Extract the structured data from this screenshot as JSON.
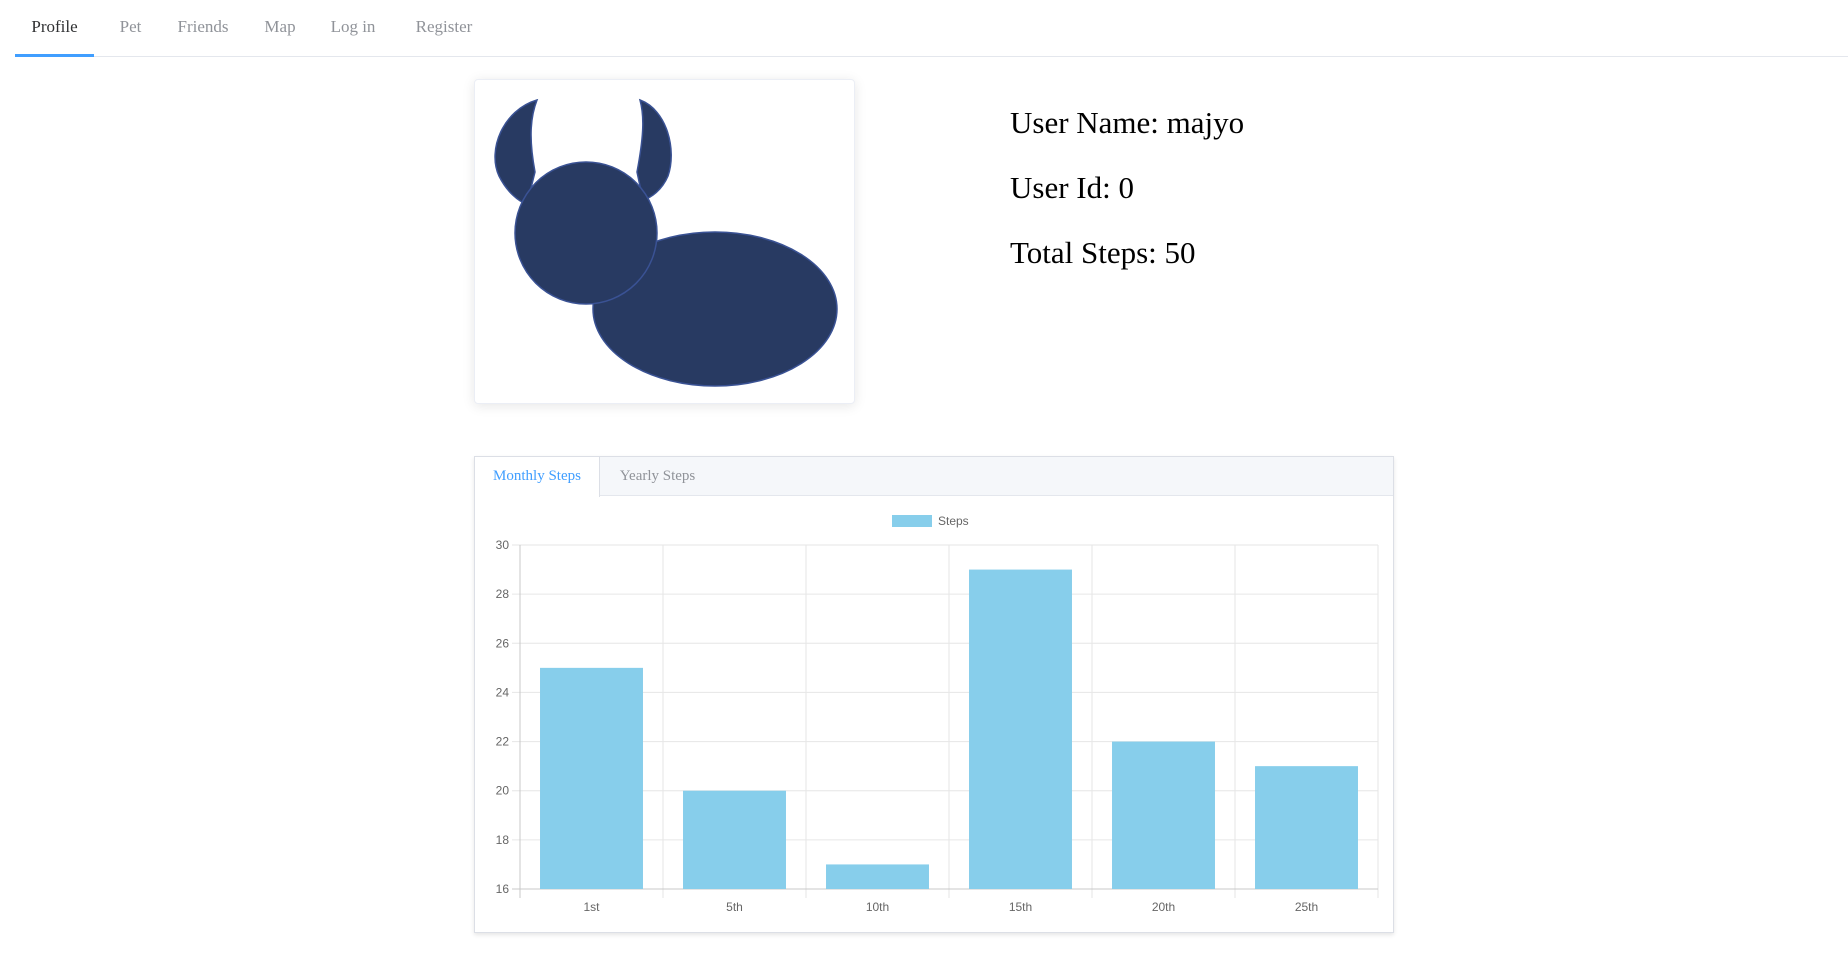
{
  "nav": {
    "items": [
      {
        "label": "Profile",
        "active": true
      },
      {
        "label": "Pet",
        "active": false
      },
      {
        "label": "Friends",
        "active": false
      },
      {
        "label": "Map",
        "active": false
      },
      {
        "label": "Log in",
        "active": false
      },
      {
        "label": "Register",
        "active": false
      }
    ]
  },
  "profile": {
    "avatar_icon": "pet-silhouette-icon",
    "user_name": "User Name: majyo",
    "user_id": "User Id: 0",
    "total_steps": "Total Steps: 50"
  },
  "tabs": [
    {
      "label": "Monthly Steps",
      "active": true
    },
    {
      "label": "Yearly Steps",
      "active": false
    }
  ],
  "colors": {
    "accent": "#409eff",
    "bar": "#87ceeb",
    "avatar": "#283a62"
  },
  "chart_data": {
    "type": "bar",
    "categories": [
      "1st",
      "5th",
      "10th",
      "15th",
      "20th",
      "25th"
    ],
    "series": [
      {
        "name": "Steps",
        "values": [
          25,
          20,
          17,
          29,
          22,
          21
        ]
      }
    ],
    "ylim": [
      16,
      30
    ],
    "yticks": [
      16,
      18,
      20,
      22,
      24,
      26,
      28,
      30
    ],
    "grid": true,
    "legend": "top-center"
  }
}
